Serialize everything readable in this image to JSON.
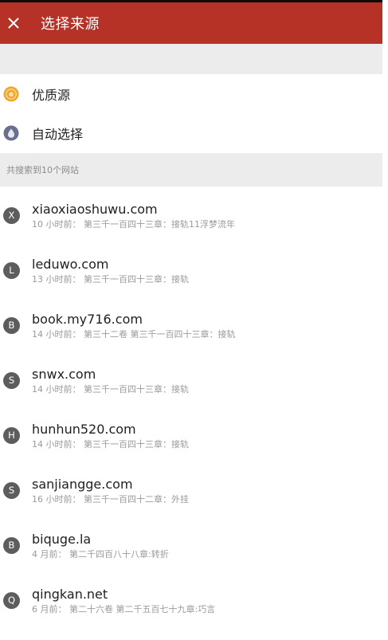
{
  "toolbar": {
    "title": "选择来源",
    "close_icon": "close-icon",
    "background": "#b63226"
  },
  "options": [
    {
      "label": "优质源",
      "icon": "quality-source-icon",
      "icon_color": "#f2a52a"
    },
    {
      "label": "自动选择",
      "icon": "auto-select-icon",
      "icon_color": "#6b6f8f"
    }
  ],
  "section": {
    "header": "共搜索到10个网站"
  },
  "sites": [
    {
      "letter": "X",
      "name": "xiaoxiaoshuwu.com",
      "info": "10 小时前： 第三千一百四十三章：接轨11浮梦流年"
    },
    {
      "letter": "L",
      "name": "leduwo.com",
      "info": "13 小时前： 第三千一百四十三章：接轨"
    },
    {
      "letter": "B",
      "name": "book.my716.com",
      "info": "14 小时前： 第三十二卷 第三千一百四十三章：接轨"
    },
    {
      "letter": "S",
      "name": "snwx.com",
      "info": "14 小时前： 第三千一百四十三章：接轨"
    },
    {
      "letter": "H",
      "name": "hunhun520.com",
      "info": "14 小时前： 第三千一百四十三章：接轨"
    },
    {
      "letter": "S",
      "name": "sanjiangge.com",
      "info": "16 小时前： 第三千一百四十二章：外挂"
    },
    {
      "letter": "B",
      "name": "biquge.la",
      "info": "4 月前： 第二千四百八十八章:转折"
    },
    {
      "letter": "Q",
      "name": "qingkan.net",
      "info": "6 月前： 第二十六卷 第二千五百七十九章:巧言"
    }
  ]
}
